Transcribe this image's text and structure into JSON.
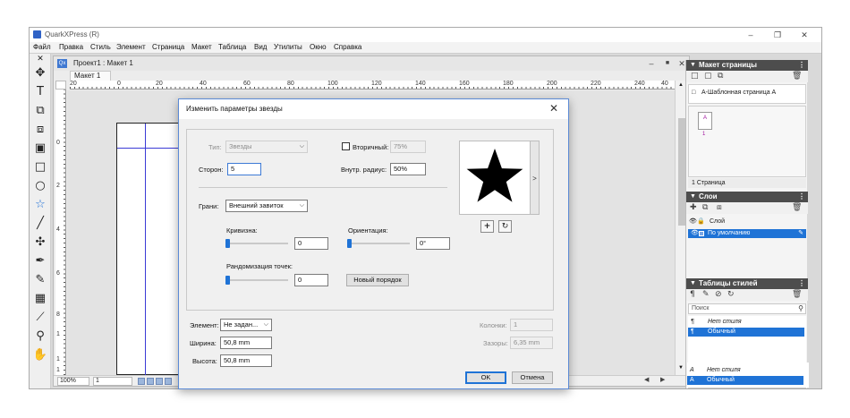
{
  "app": {
    "title": "QuarkXPress (R)",
    "window_controls": [
      "–",
      "❐",
      "✕"
    ],
    "menu": [
      "Файл",
      "Правка",
      "Стиль",
      "Элемент",
      "Страница",
      "Макет",
      "Таблица",
      "Вид",
      "Утилиты",
      "Окно",
      "Справка"
    ]
  },
  "document": {
    "title": "Проект1 : Макет 1",
    "tab": "Макет 1",
    "ruler_labels": [
      "20",
      "0",
      "20",
      "40",
      "60",
      "80",
      "100",
      "120",
      "140",
      "160",
      "180",
      "200",
      "220",
      "240",
      "40"
    ],
    "vruler_labels": [
      "0",
      "2",
      "4",
      "6",
      "8",
      "1",
      "1",
      "1"
    ],
    "zoom": "100%",
    "page_field": "1"
  },
  "dialog": {
    "title": "Изменить параметры звезды",
    "type_label": "Тип:",
    "type_value": "Звезды",
    "secondary_label": "Вторичный:",
    "secondary_value": "75%",
    "sides_label": "Сторон:",
    "sides_value": "5",
    "inner_radius_label": "Внутр. радиус:",
    "inner_radius_value": "50%",
    "edges_label": "Грани:",
    "edges_value": "Внешний завиток",
    "curvature_label": "Кривизна:",
    "curvature_value": "0",
    "orientation_label": "Ориентация:",
    "orientation_value": "0°",
    "randomize_label": "Рандомизация точек:",
    "randomize_value": "0",
    "new_order_button": "Новый порядок",
    "element_label": "Элемент:",
    "element_value": "Не задан...",
    "width_label": "Ширина:",
    "width_value": "50,8 mm",
    "height_label": "Высота:",
    "height_value": "50,8 mm",
    "columns_label": "Колонки:",
    "columns_value": "1",
    "gutter_label": "Зазоры:",
    "gutter_value": "6,35 mm",
    "ok_button": "OK",
    "cancel_button": "Отмена",
    "add_button": "+",
    "reset_button": "↻",
    "preview_arrow": ">",
    "close": "✕"
  },
  "panels": {
    "page_layout": {
      "title": "Макет страницы",
      "master": "А-Шаблонная страница А",
      "page_thumb_letter": "A",
      "page_number": "1",
      "pages_count": "1 Страница"
    },
    "layers": {
      "title": "Слои",
      "header": "Слой",
      "items": [
        "По умолчанию"
      ]
    },
    "style_sheets": {
      "title": "Таблицы стилей",
      "search_placeholder": "Поиск",
      "paragraph_styles": [
        "Нет стиля",
        "Обычный"
      ],
      "character_styles": [
        "Нет стиля",
        "Обычный"
      ]
    }
  },
  "colors": {
    "accent": "#1f73d6",
    "panel_header": "#4d4d4d",
    "margin_guide": "#3a3ad6"
  }
}
